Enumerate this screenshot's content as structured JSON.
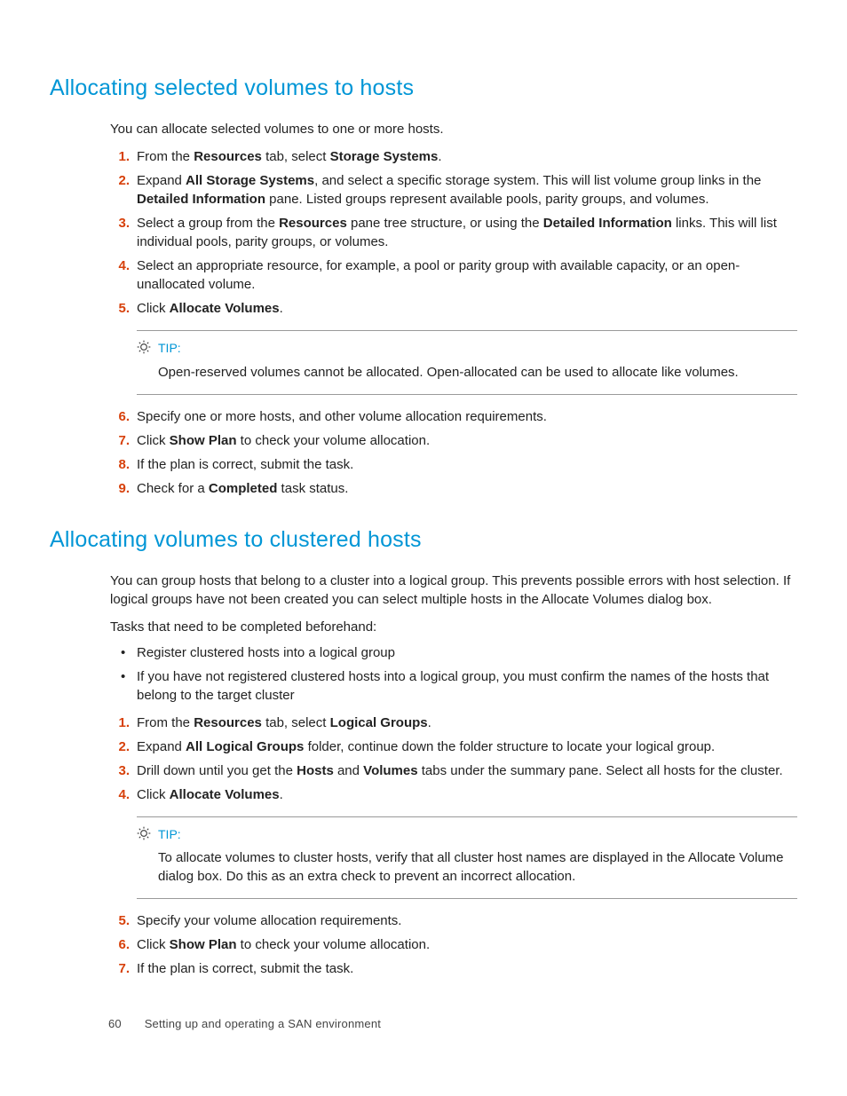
{
  "section1": {
    "heading": "Allocating selected volumes to hosts",
    "intro": "You can allocate selected volumes to one or more hosts.",
    "steps_a": [
      {
        "num": "1.",
        "parts": [
          "From the ",
          {
            "b": "Resources"
          },
          " tab, select ",
          {
            "b": "Storage Systems"
          },
          "."
        ]
      },
      {
        "num": "2.",
        "parts": [
          "Expand ",
          {
            "b": "All Storage Systems"
          },
          ", and select a specific storage system. This will list volume group links in the ",
          {
            "b": "Detailed Information"
          },
          " pane. Listed groups represent available pools, parity groups, and volumes."
        ]
      },
      {
        "num": "3.",
        "parts": [
          "Select a group from the ",
          {
            "b": "Resources"
          },
          " pane tree structure, or using the ",
          {
            "b": "Detailed Information"
          },
          " links. This will list individual pools, parity groups, or volumes."
        ]
      },
      {
        "num": "4.",
        "parts": [
          "Select an appropriate resource, for example, a pool or parity group with available capacity, or an open-unallocated volume."
        ]
      },
      {
        "num": "5.",
        "parts": [
          "Click ",
          {
            "b": "Allocate Volumes"
          },
          "."
        ]
      }
    ],
    "tip": {
      "label": "TIP:",
      "body": "Open-reserved volumes cannot be allocated. Open-allocated can be used to allocate like volumes."
    },
    "steps_b": [
      {
        "num": "6.",
        "parts": [
          "Specify one or more hosts, and other volume allocation requirements."
        ]
      },
      {
        "num": "7.",
        "parts": [
          "Click ",
          {
            "b": "Show Plan"
          },
          " to check your volume allocation."
        ]
      },
      {
        "num": "8.",
        "parts": [
          "If the plan is correct, submit the task."
        ]
      },
      {
        "num": "9.",
        "parts": [
          "Check for a ",
          {
            "b": "Completed"
          },
          " task status."
        ]
      }
    ]
  },
  "section2": {
    "heading": "Allocating volumes to clustered hosts",
    "intro": "You can group hosts that belong to a cluster into a logical group. This prevents possible errors with host selection. If logical groups have not been created you can select multiple hosts in the Allocate Volumes dialog box.",
    "tasks_label": "Tasks that need to be completed beforehand:",
    "bullets": [
      {
        "parts": [
          "Register clustered hosts into a logical group"
        ]
      },
      {
        "parts": [
          "If you have not registered clustered hosts into a logical group, you must confirm the names of the hosts that belong to the target cluster"
        ]
      }
    ],
    "steps_a": [
      {
        "num": "1.",
        "parts": [
          "From the ",
          {
            "b": "Resources"
          },
          " tab, select ",
          {
            "b": "Logical Groups"
          },
          "."
        ]
      },
      {
        "num": "2.",
        "parts": [
          "Expand ",
          {
            "b": "All Logical Groups"
          },
          " folder, continue down the folder structure to locate your logical group."
        ]
      },
      {
        "num": "3.",
        "parts": [
          "Drill down until you get the ",
          {
            "b": "Hosts"
          },
          " and ",
          {
            "b": "Volumes"
          },
          " tabs under the summary pane. Select all hosts for the cluster."
        ]
      },
      {
        "num": "4.",
        "parts": [
          "Click ",
          {
            "b": "Allocate Volumes"
          },
          "."
        ]
      }
    ],
    "tip": {
      "label": "TIP:",
      "body": "To allocate volumes to cluster hosts, verify that all cluster host names are displayed in the Allocate Volume dialog box. Do this as an extra check to prevent an incorrect allocation."
    },
    "steps_b": [
      {
        "num": "5.",
        "parts": [
          "Specify your volume allocation requirements."
        ]
      },
      {
        "num": "6.",
        "parts": [
          "Click ",
          {
            "b": "Show Plan"
          },
          " to check your volume allocation."
        ]
      },
      {
        "num": "7.",
        "parts": [
          "If the plan is correct, submit the task."
        ]
      }
    ]
  },
  "footer": {
    "page": "60",
    "title": "Setting up and operating a SAN environment"
  }
}
